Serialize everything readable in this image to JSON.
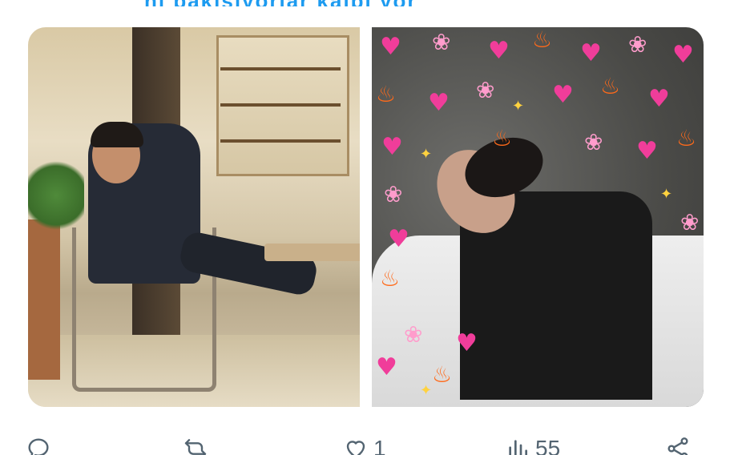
{
  "tweet": {
    "text_fragment": "ni bakışıyorlar kalbi yor"
  },
  "media": [
    {
      "id_label": "cafe-photo"
    },
    {
      "id_label": "emoji-edit-photo"
    }
  ],
  "actions": {
    "reply_count": "",
    "retweet_count": "",
    "like_count": "1",
    "views_count": "55"
  },
  "colors": {
    "accent": "#1d9bf0",
    "icon_gray": "#536471"
  }
}
